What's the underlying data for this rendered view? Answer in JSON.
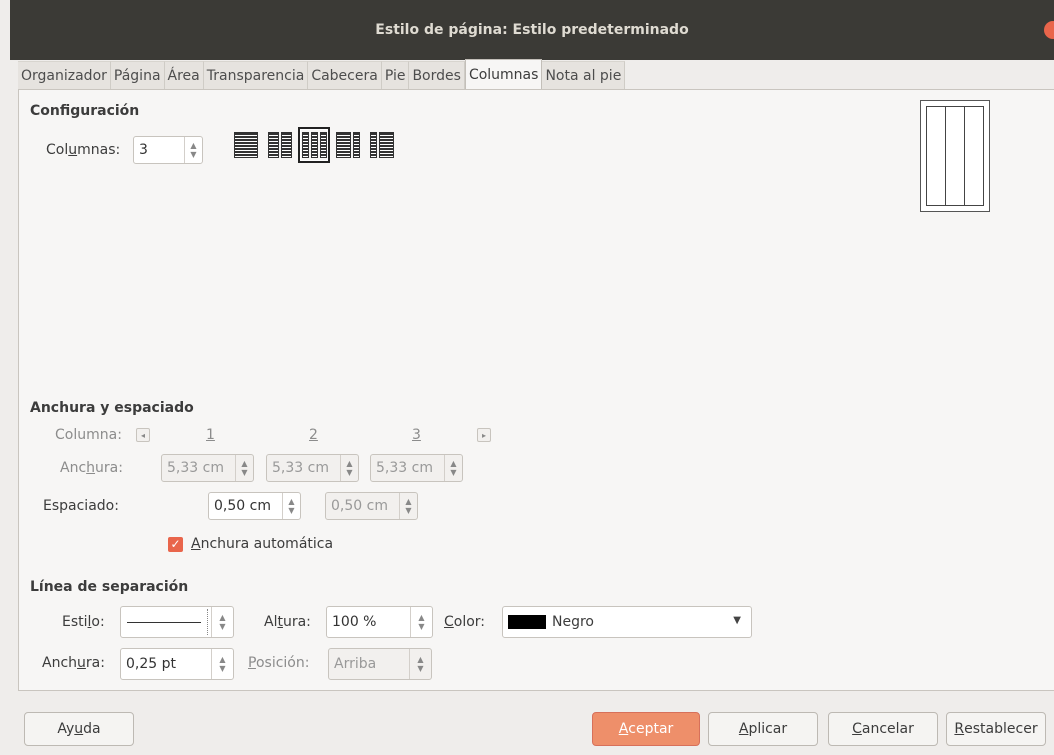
{
  "window": {
    "title": "Estilo de página: Estilo predeterminado"
  },
  "tabs": [
    "Organizador",
    "Página",
    "Área",
    "Transparencia",
    "Cabecera",
    "Pie",
    "Bordes",
    "Columnas",
    "Nota al pie"
  ],
  "active_tab": "Columnas",
  "config": {
    "heading": "Configuración",
    "columns_label_pre": "Col",
    "columns_label_u": "u",
    "columns_label_post": "mnas:",
    "columns_value": "3"
  },
  "width_spacing": {
    "heading": "Anchura y espaciado",
    "column_label": "Columna:",
    "col_numbers": [
      "1",
      "2",
      "3"
    ],
    "width_label_pre": "Anc",
    "width_label_u": "h",
    "width_label_post": "ura:",
    "widths": [
      "5,33 cm",
      "5,33 cm",
      "5,33 cm"
    ],
    "spacing_label": "Espaciado:",
    "spacings": [
      "0,50 cm",
      "0,50 cm"
    ],
    "autowidth_u": "A",
    "autowidth_rest": "nchura automática",
    "autowidth_checked": true
  },
  "separator": {
    "heading": "Línea de separación",
    "style_pre": "Esti",
    "style_u": "l",
    "style_post": "o:",
    "height_pre": "Al",
    "height_u": "t",
    "height_post": "ura:",
    "height_value": "100 %",
    "color_u": "C",
    "color_post": "olor:",
    "color_value": "Negro",
    "color_hex": "#000000",
    "width_pre": "Anch",
    "width_u": "u",
    "width_post": "ra:",
    "width_value": "0,25 pt",
    "position_u": "P",
    "position_post": "osición:",
    "position_value": "Arriba"
  },
  "buttons": {
    "help_pre": "Ay",
    "help_u": "u",
    "help_post": "da",
    "ok_u": "A",
    "ok_rest": "ceptar",
    "apply_u": "A",
    "apply_rest": "plicar",
    "cancel_u": "C",
    "cancel_rest": "ancelar",
    "reset_u": "R",
    "reset_rest": "establecer"
  },
  "colors": {
    "accent": "#e9654b",
    "titlebar": "#3b3a36",
    "ok_button": "#ee8f6a"
  }
}
